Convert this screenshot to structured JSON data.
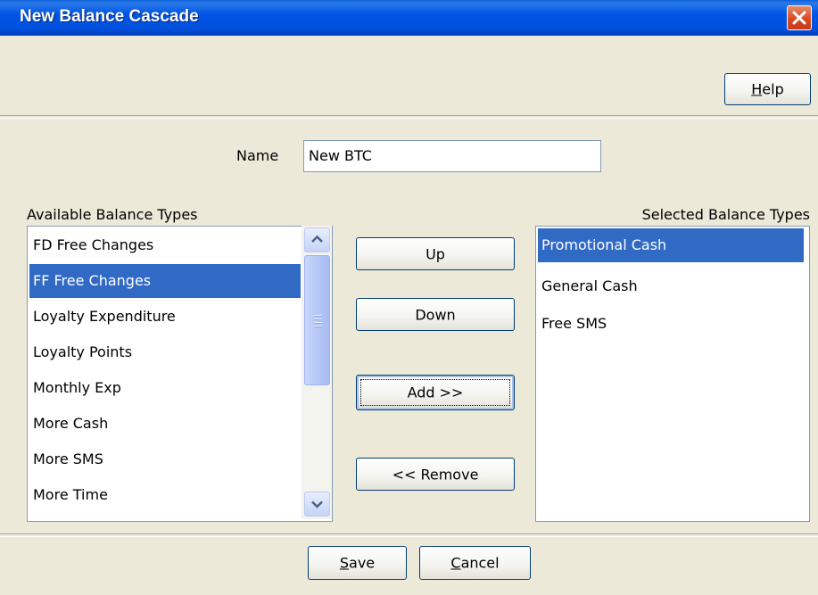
{
  "window": {
    "title": "New Balance Cascade"
  },
  "toolbar": {
    "help_label": "Help",
    "help_mnemonic": "H",
    "help_rest": "elp"
  },
  "form": {
    "name_label": "Name",
    "name_value": "New BTC",
    "available_label": "Available Balance Types",
    "selected_label": "Selected Balance Types"
  },
  "available": {
    "items": [
      "FD Free Changes",
      "FF Free Changes",
      "Loyalty Expenditure",
      "Loyalty Points",
      "Monthly Exp",
      "More Cash",
      "More SMS",
      "More Time"
    ],
    "selected_item": "FF Free Changes"
  },
  "selected": {
    "items": [
      "Promotional Cash",
      "General Cash",
      "Free SMS"
    ],
    "selected_item": "Promotional Cash"
  },
  "actions": {
    "up": "Up",
    "down": "Down",
    "add": "Add >>",
    "remove": "<< Remove"
  },
  "footer": {
    "save_label": "Save",
    "save_mnemonic": "S",
    "save_rest": "ave",
    "cancel_label": "Cancel",
    "cancel_mnemonic": "C",
    "cancel_rest": "ancel"
  },
  "colors": {
    "title_bar": "#0055e5",
    "selection": "#316ac5",
    "dialog_bg": "#ece9d8",
    "close_button": "#d94b24"
  }
}
